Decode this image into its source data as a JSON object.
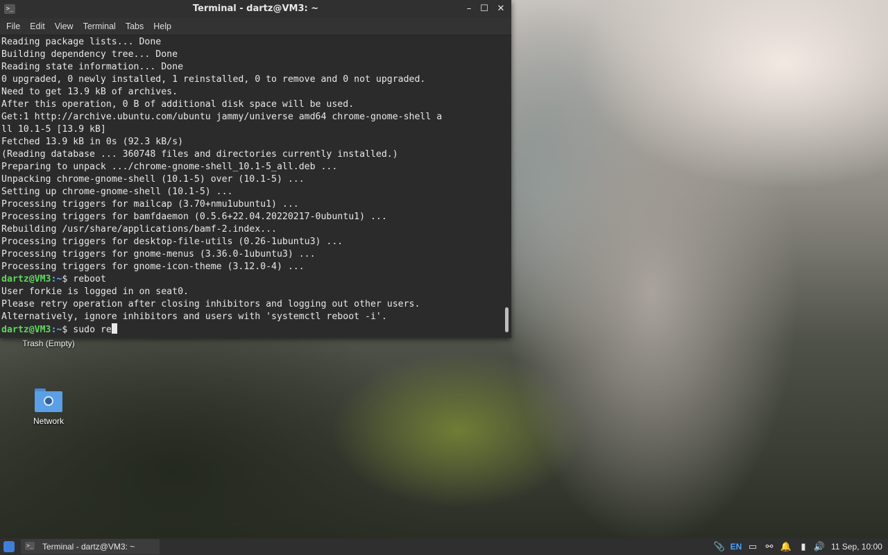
{
  "window": {
    "title": "Terminal - dartz@VM3: ~",
    "buttons": {
      "minimize": "–",
      "maximize": "☐",
      "close": "✕"
    },
    "app_icon": ">_"
  },
  "menu": [
    "File",
    "Edit",
    "View",
    "Terminal",
    "Tabs",
    "Help"
  ],
  "terminal": {
    "output_lines": [
      "Reading package lists... Done",
      "Building dependency tree... Done",
      "Reading state information... Done",
      "0 upgraded, 0 newly installed, 1 reinstalled, 0 to remove and 0 not upgraded.",
      "Need to get 13.9 kB of archives.",
      "After this operation, 0 B of additional disk space will be used.",
      "Get:1 http://archive.ubuntu.com/ubuntu jammy/universe amd64 chrome-gnome-shell a",
      "ll 10.1-5 [13.9 kB]",
      "Fetched 13.9 kB in 0s (92.3 kB/s)",
      "(Reading database ... 360748 files and directories currently installed.)",
      "Preparing to unpack .../chrome-gnome-shell_10.1-5_all.deb ...",
      "Unpacking chrome-gnome-shell (10.1-5) over (10.1-5) ...",
      "Setting up chrome-gnome-shell (10.1-5) ...",
      "Processing triggers for mailcap (3.70+nmu1ubuntu1) ...",
      "Processing triggers for bamfdaemon (0.5.6+22.04.20220217-0ubuntu1) ...",
      "Rebuilding /usr/share/applications/bamf-2.index...",
      "Processing triggers for desktop-file-utils (0.26-1ubuntu3) ...",
      "Processing triggers for gnome-menus (3.36.0-1ubuntu3) ...",
      "Processing triggers for gnome-icon-theme (3.12.0-4) ..."
    ],
    "prompt_user": "dartz@VM3",
    "prompt_path": ":~",
    "prompt_symbol": "$ ",
    "command1": "reboot",
    "reboot_output": [
      "User forkie is logged in on seat0.",
      "Please retry operation after closing inhibitors and logging out other users.",
      "Alternatively, ignore inhibitors and users with 'systemctl reboot -i'."
    ],
    "current_input": "sudo re"
  },
  "desktop": {
    "icons": [
      {
        "label": "Trash (Empty)",
        "icon": "trash-icon"
      },
      {
        "label": "Network",
        "icon": "network-folder-icon"
      }
    ]
  },
  "taskbar": {
    "task_label": "Terminal - dartz@VM3: ~",
    "keyboard_layout": "EN",
    "clock": "11 Sep, 10:00",
    "tray_icons": [
      "clipboard-icon",
      "display-icon",
      "network-icon",
      "notification-bell-icon",
      "battery-icon",
      "volume-icon"
    ]
  },
  "colors": {
    "prompt_user": "#5fd75f",
    "prompt_path": "#5fafff",
    "terminal_bg": "#2b2b2b",
    "lang_indicator": "#4aa3ff"
  }
}
